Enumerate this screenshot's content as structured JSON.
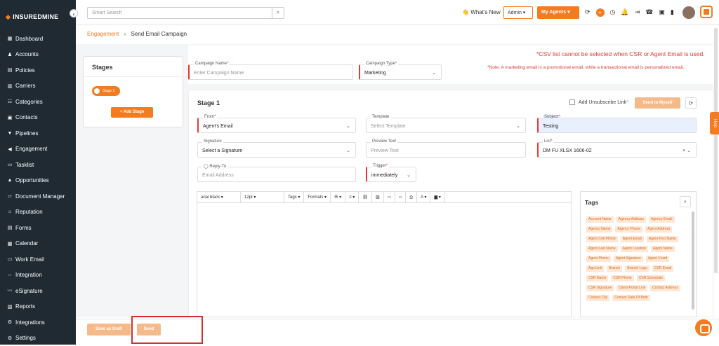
{
  "app": {
    "logo": "INSUREDMINE"
  },
  "sidebar": {
    "items": [
      {
        "label": "Dashboard"
      },
      {
        "label": "Accounts"
      },
      {
        "label": "Policies"
      },
      {
        "label": "Carriers"
      },
      {
        "label": "Categories"
      },
      {
        "label": "Contacts"
      },
      {
        "label": "Pipelines"
      },
      {
        "label": "Engagement"
      },
      {
        "label": "Tasklist"
      },
      {
        "label": "Opportunities"
      },
      {
        "label": "Document Manager"
      },
      {
        "label": "Reputation"
      },
      {
        "label": "Forms"
      },
      {
        "label": "Calendar"
      },
      {
        "label": "Work Email"
      },
      {
        "label": "Integration"
      },
      {
        "label": "eSignature"
      },
      {
        "label": "Reports"
      },
      {
        "label": "Integrations"
      },
      {
        "label": "Settings"
      }
    ]
  },
  "topbar": {
    "search_placeholder": "Smart Search",
    "whats_new": "What's New",
    "admin": "Admin",
    "my_agents": "My Agents"
  },
  "breadcrumb": {
    "parent": "Engagement",
    "current": "Send Email Campaign"
  },
  "stages": {
    "title": "Stages",
    "stage_pill": "Stage 1",
    "add_stage": "+ Add Stage"
  },
  "campaign": {
    "name_label": "Campaign Name",
    "name_placeholder": "Enter Campaign Name",
    "type_label": "Campaign Type",
    "type_value": "Marketing",
    "error_csv": "*CSV list cannot be selected when CSR or Agent Email is used.",
    "note": "*Note: A marketing email is a promotional email, while a transactional email is personalized email."
  },
  "stage_form": {
    "title": "Stage 1",
    "unsubscribe_label": "Add Unsubscribe Link",
    "send_to_myself": "Send to Myself",
    "from_label": "From",
    "from_value": "Agent's Email",
    "template_label": "Template",
    "template_placeholder": "Select Template",
    "subject_label": "Subject",
    "subject_value": "Testing",
    "signature_label": "Signature",
    "signature_value": "Select a Signature",
    "preview_label": "Preview Text",
    "preview_placeholder": "Preview Text",
    "list_label": "List",
    "list_value": "DM FU XLSX 1606-02",
    "reply_label": "Reply-To",
    "reply_placeholder": "Email Address",
    "trigger_label": "Trigger",
    "trigger_value": "immediately"
  },
  "editor": {
    "font": "arial black",
    "size": "12pt",
    "tags_menu": "Tags",
    "formats_menu": "Formats"
  },
  "tags": {
    "title": "Tags",
    "items": [
      "Account Name",
      "Agency Address",
      "Agency Email",
      "Agency Name",
      "Agency Phone",
      "Agent Address",
      "Agent Cell Phone",
      "Agent Email",
      "Agent First Name",
      "Agent Last Name",
      "Agent Location",
      "Agent Name",
      "Agent Phone",
      "Agent Signature",
      "Agent Vcard",
      "App Link",
      "Branch",
      "Branch Logo",
      "CSR Email",
      "CSR Name",
      "CSR Phone",
      "CSR Scheduler",
      "CSR Signature",
      "Client Portal Link",
      "Contact Address",
      "Contact City",
      "Contact Date Of Birth"
    ]
  },
  "footer": {
    "save_draft": "Save as Draft",
    "send": "Send"
  },
  "help_tab": "Help",
  "colors": {
    "brand": "#f47b20",
    "sidebar": "#1f2a33",
    "error": "#e53935"
  }
}
